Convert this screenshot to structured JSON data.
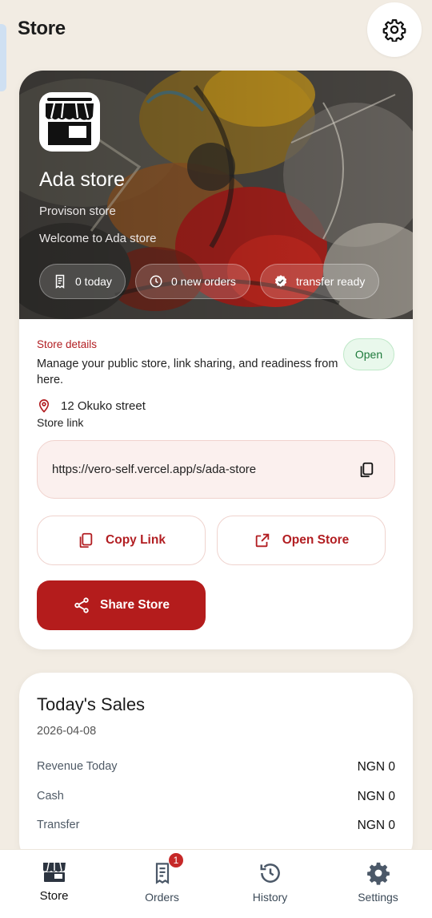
{
  "header": {
    "title": "Store"
  },
  "hero": {
    "store_name": "Ada store",
    "store_type": "Provison store",
    "welcome": "Welcome to Ada store",
    "chips": [
      {
        "icon": "receipt-icon",
        "label": "0 today"
      },
      {
        "icon": "clock-icon",
        "label": "0 new orders"
      },
      {
        "icon": "verified-icon",
        "label": "transfer ready"
      }
    ]
  },
  "details": {
    "label": "Store details",
    "description": "Manage your public store, link sharing, and readiness from here.",
    "status": "Open",
    "address": "12 Okuko street",
    "link_label": "Store link",
    "link": "https://vero-self.vercel.app/s/ada-store"
  },
  "actions": {
    "copy": "Copy Link",
    "open": "Open Store",
    "share": "Share Store"
  },
  "sales": {
    "title": "Today's Sales",
    "date": "2026-04-08",
    "rows": [
      {
        "label": "Revenue Today",
        "value": "NGN 0"
      },
      {
        "label": "Cash",
        "value": "NGN 0"
      },
      {
        "label": "Transfer",
        "value": "NGN 0"
      }
    ]
  },
  "nav": {
    "items": [
      {
        "label": "Store",
        "icon": "store-icon",
        "active": true
      },
      {
        "label": "Orders",
        "icon": "receipt-icon",
        "badge": "1"
      },
      {
        "label": "History",
        "icon": "history-icon"
      },
      {
        "label": "Settings",
        "icon": "gear-icon"
      }
    ]
  },
  "colors": {
    "accent": "#b41c1c",
    "background": "#f2ece3",
    "open_badge": "#e9f8ec"
  }
}
